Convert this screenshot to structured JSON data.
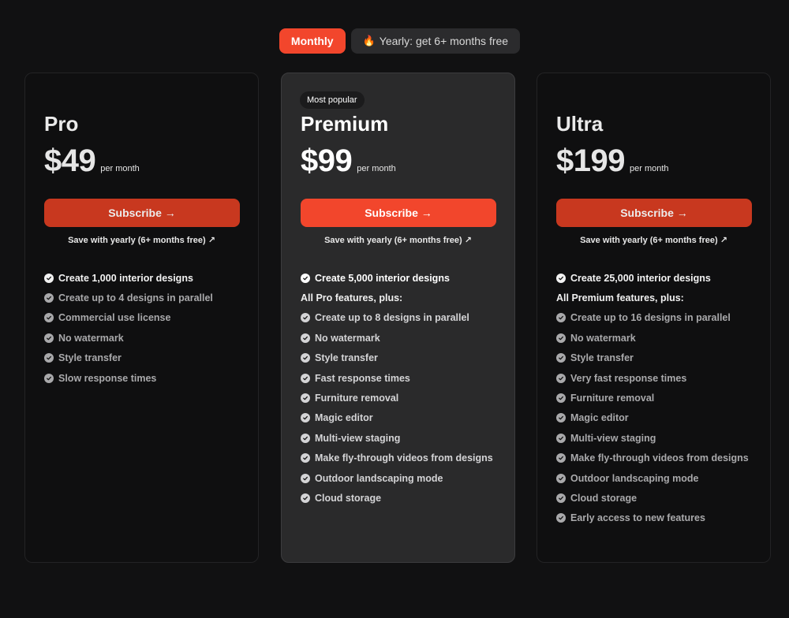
{
  "billing_toggle": {
    "monthly_label": "Monthly",
    "yearly_label": "Yearly: get 6+ months free",
    "yearly_icon": "fire-icon",
    "selected": "Monthly"
  },
  "colors": {
    "accent": "#f2462c",
    "accent_muted": "#c8381f",
    "background": "#111112",
    "card_highlight": "#2a2a2b"
  },
  "plans": [
    {
      "name": "Pro",
      "badge": "",
      "price": "$49",
      "period": "per month",
      "cta": "Subscribe →",
      "save_link": "Save with yearly (6+ months free) ↗",
      "features": [
        "Create 1,000 interior designs",
        "Create up to 4 designs in parallel",
        "Commercial use license",
        "No watermark",
        "Style transfer",
        "Slow response times"
      ]
    },
    {
      "name": "Premium",
      "badge": "Most popular",
      "price": "$99",
      "period": "per month",
      "cta": "Subscribe →",
      "save_link": "Save with yearly (6+ months free) ↗",
      "features": [
        "Create 5,000 interior designs",
        "All Pro features, plus:",
        "Create up to 8 designs in parallel",
        "No watermark",
        "Style transfer",
        "Fast response times",
        "Furniture removal",
        "Magic editor",
        "Multi-view staging",
        "Make fly-through videos from designs",
        "Outdoor landscaping mode",
        "Cloud storage"
      ]
    },
    {
      "name": "Ultra",
      "badge": "",
      "price": "$199",
      "period": "per month",
      "cta": "Subscribe →",
      "save_link": "Save with yearly (6+ months free) ↗",
      "features": [
        "Create 25,000 interior designs",
        "All Premium features, plus:",
        "Create up to 16 designs in parallel",
        "No watermark",
        "Style transfer",
        "Very fast response times",
        "Furniture removal",
        "Magic editor",
        "Multi-view staging",
        "Make fly-through videos from designs",
        "Outdoor landscaping mode",
        "Cloud storage",
        "Early access to new features"
      ]
    }
  ]
}
